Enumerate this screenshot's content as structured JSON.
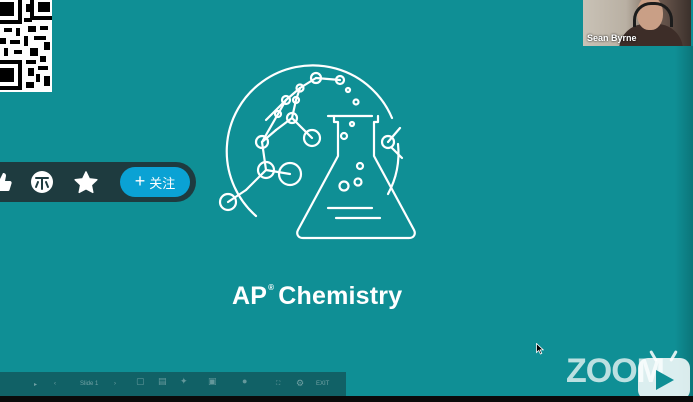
{
  "webcam": {
    "participant_name": "Sean Byrne"
  },
  "follow_bar": {
    "icons": [
      "thumbs-up-icon",
      "coin-icon",
      "star-icon"
    ],
    "follow_label": "关注",
    "follow_plus": "+"
  },
  "slide": {
    "title_ap": "AP",
    "title_reg": "®",
    "title_subject": "Chemistry"
  },
  "toolbar": {
    "slide_label": "Slide 1",
    "exit_label": "EXIT"
  },
  "watermark": {
    "zoom_text": "ZOOM"
  },
  "colors": {
    "background": "#0f8f95",
    "follow_bar": "#1e3b3f",
    "follow_button": "#0aa2d4",
    "text": "#ffffff"
  }
}
